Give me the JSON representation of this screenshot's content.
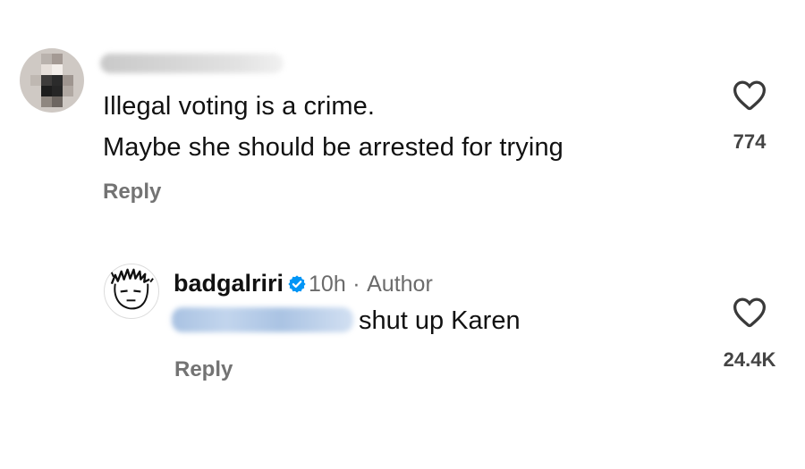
{
  "comment": {
    "text_line1": "Illegal voting is a crime.",
    "text_line2": "Maybe she should be arrested for trying",
    "reply_label": "Reply",
    "likes": "774"
  },
  "reply": {
    "username": "badgalriri",
    "time": "10h",
    "separator": "·",
    "author_label": "Author",
    "text": "shut up Karen",
    "reply_label": "Reply",
    "likes": "24.4K"
  },
  "icons": {
    "heart": "heart-outline-icon",
    "verified": "verified-badge-icon"
  },
  "colors": {
    "verified_blue": "#0095f6",
    "secondary_text": "#737373"
  }
}
